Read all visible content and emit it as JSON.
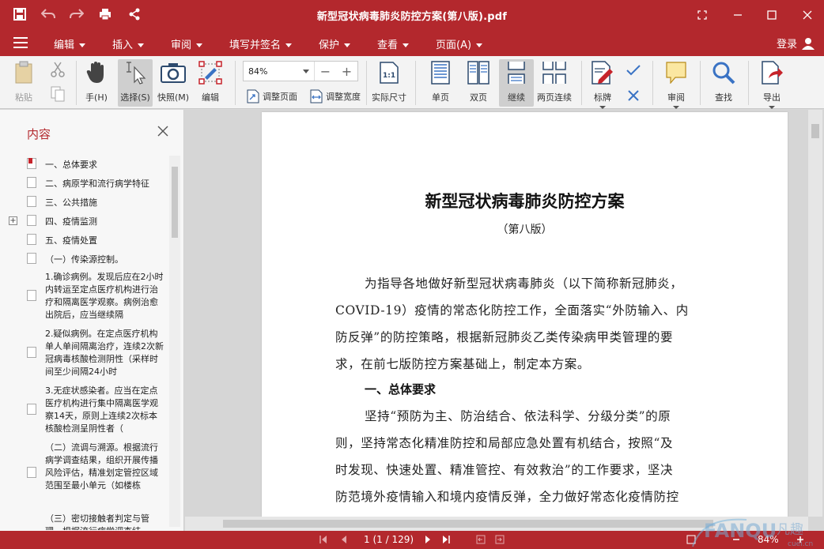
{
  "window": {
    "title": "新型冠状病毒肺炎防控方案(第八版).pdf"
  },
  "menu": {
    "items": [
      "编辑",
      "插入",
      "审阅",
      "填写并签名",
      "保护",
      "查看",
      "页面(A)"
    ],
    "login": "登录"
  },
  "toolbar": {
    "paste": "粘贴",
    "hand": "手(H)",
    "select": "选择(S)",
    "snapshot": "快照(M)",
    "edit": "编辑",
    "zoom_value": "84%",
    "fit_page": "调整页面",
    "fit_width": "调整宽度",
    "actual_size": "实际尺寸",
    "single": "单页",
    "double": "双页",
    "continuous": "继续",
    "two_continuous": "两页连续",
    "stamp": "标牌",
    "review": "审阅",
    "find": "查找",
    "export": "导出"
  },
  "sidebar": {
    "title": "内容",
    "items": [
      "一、总体要求",
      "二、病原学和流行病学特征",
      "三、公共措施",
      "四、疫情监测",
      "五、疫情处置",
      "（一）传染源控制。",
      "1.确诊病例。发现后应在2小时内转运至定点医疗机构进行治疗和隔离医学观察。病例治愈出院后，应当继续隔",
      "2.疑似病例。在定点医疗机构单人单间隔离治疗，连续2次新冠病毒核酸检测阴性（采样时间至少间隔24小时",
      "3.无症状感染者。应当在定点医疗机构进行集中隔离医学观察14天，原则上连续2次标本核酸检测呈阴性者（",
      "（二）流调与溯源。根据流行病学调查结果，组织开展传播风险评估，精准划定管控区域范围至最小单元（如楼栋",
      "（三）密切接触者判定与管理。根据流行病学调查结"
    ]
  },
  "document": {
    "title": "新型冠状病毒肺炎防控方案",
    "subtitle": "（第八版）",
    "lines": [
      "为指导各地做好新型冠状病毒肺炎（以下简称新冠肺炎，",
      "COVID-19）疫情的常态化防控工作，全面落实“外防输入、内",
      "防反弹”的防控策略，根据新冠肺炎乙类传染病甲类管理的要",
      "求，在前七版防控方案基础上，制定本方案。",
      "坚持“预防为主、防治结合、依法科学、分级分类”的原",
      "则，坚持常态化精准防控和局部应急处置有机结合，按照“及",
      "时发现、快速处置、精准管控、有效救治”的工作要求，坚决",
      "防范境外疫情输入和境内疫情反弹，全力做好常态化疫情防控"
    ],
    "heading1": "一、总体要求"
  },
  "status": {
    "page": "1 (1 / 129)",
    "zoom": "84%"
  },
  "watermark": {
    "brand": "FANQU",
    "cn": "凡趣",
    "site": "cuei.cn"
  }
}
